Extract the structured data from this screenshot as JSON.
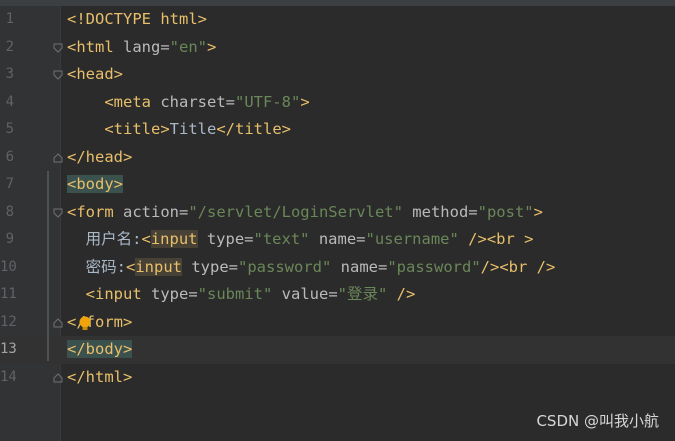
{
  "editor": {
    "lines": [
      {
        "num": "1",
        "parts": [
          {
            "c": "doctype",
            "s": "<!DOCTYPE html>"
          }
        ]
      },
      {
        "num": "2",
        "parts": [
          {
            "c": "t",
            "s": "<html "
          },
          {
            "c": "a",
            "s": "lang="
          },
          {
            "c": "v",
            "s": "\"en\""
          },
          {
            "c": "t",
            "s": ">"
          }
        ]
      },
      {
        "num": "3",
        "parts": [
          {
            "c": "t",
            "s": "<head>"
          }
        ]
      },
      {
        "num": "4",
        "parts": [
          {
            "c": "txt",
            "s": "    "
          },
          {
            "c": "t",
            "s": "<meta "
          },
          {
            "c": "a",
            "s": "charset="
          },
          {
            "c": "v",
            "s": "\"UTF-8\""
          },
          {
            "c": "t",
            "s": ">"
          }
        ]
      },
      {
        "num": "5",
        "parts": [
          {
            "c": "txt",
            "s": "    "
          },
          {
            "c": "t",
            "s": "<title>"
          },
          {
            "c": "txt",
            "s": "Title"
          },
          {
            "c": "t",
            "s": "</title>"
          }
        ]
      },
      {
        "num": "6",
        "parts": [
          {
            "c": "t",
            "s": "</head>"
          }
        ]
      },
      {
        "num": "7",
        "parts": [
          {
            "c": "t hl-tag",
            "s": "<body>"
          }
        ]
      },
      {
        "num": "8",
        "parts": [
          {
            "c": "t",
            "s": "<form "
          },
          {
            "c": "a",
            "s": "action="
          },
          {
            "c": "v",
            "s": "\"/servlet/LoginServlet\""
          },
          {
            "c": "a",
            "s": " method="
          },
          {
            "c": "v",
            "s": "\"post\""
          },
          {
            "c": "t",
            "s": ">"
          }
        ]
      },
      {
        "num": "9",
        "parts": [
          {
            "c": "txt",
            "s": "  用户名:"
          },
          {
            "c": "t",
            "s": "<"
          },
          {
            "c": "t hl-input",
            "s": "input"
          },
          {
            "c": "a",
            "s": " type="
          },
          {
            "c": "v",
            "s": "\"text\""
          },
          {
            "c": "a",
            "s": " name="
          },
          {
            "c": "v",
            "s": "\"username\""
          },
          {
            "c": "t",
            "s": " /><br >"
          }
        ]
      },
      {
        "num": "10",
        "parts": [
          {
            "c": "txt",
            "s": "  密码:"
          },
          {
            "c": "t",
            "s": "<"
          },
          {
            "c": "t hl-input",
            "s": "input"
          },
          {
            "c": "a",
            "s": " type="
          },
          {
            "c": "v",
            "s": "\"password\""
          },
          {
            "c": "a",
            "s": " name="
          },
          {
            "c": "v",
            "s": "\"password\""
          },
          {
            "c": "t",
            "s": "/><br />"
          }
        ]
      },
      {
        "num": "11",
        "parts": [
          {
            "c": "txt",
            "s": "  "
          },
          {
            "c": "t",
            "s": "<input "
          },
          {
            "c": "a",
            "s": "type="
          },
          {
            "c": "v",
            "s": "\"submit\""
          },
          {
            "c": "a",
            "s": " value="
          },
          {
            "c": "v",
            "s": "\"登录\""
          },
          {
            "c": "t",
            "s": " />"
          }
        ]
      },
      {
        "num": "12",
        "parts": [
          {
            "c": "t",
            "s": "</form>"
          }
        ]
      },
      {
        "num": "13",
        "parts": [
          {
            "c": "t hl-tag",
            "s": "</body>"
          }
        ]
      },
      {
        "num": "14",
        "parts": [
          {
            "c": "t",
            "s": "</html>"
          }
        ]
      }
    ],
    "current_line": "13"
  },
  "watermark": "CSDN @叫我小航",
  "colors": {
    "background": "#2b2b2b",
    "tag": "#e8bf6a",
    "attribute": "#bababa",
    "string": "#6a8759",
    "text": "#a9b7c6"
  }
}
